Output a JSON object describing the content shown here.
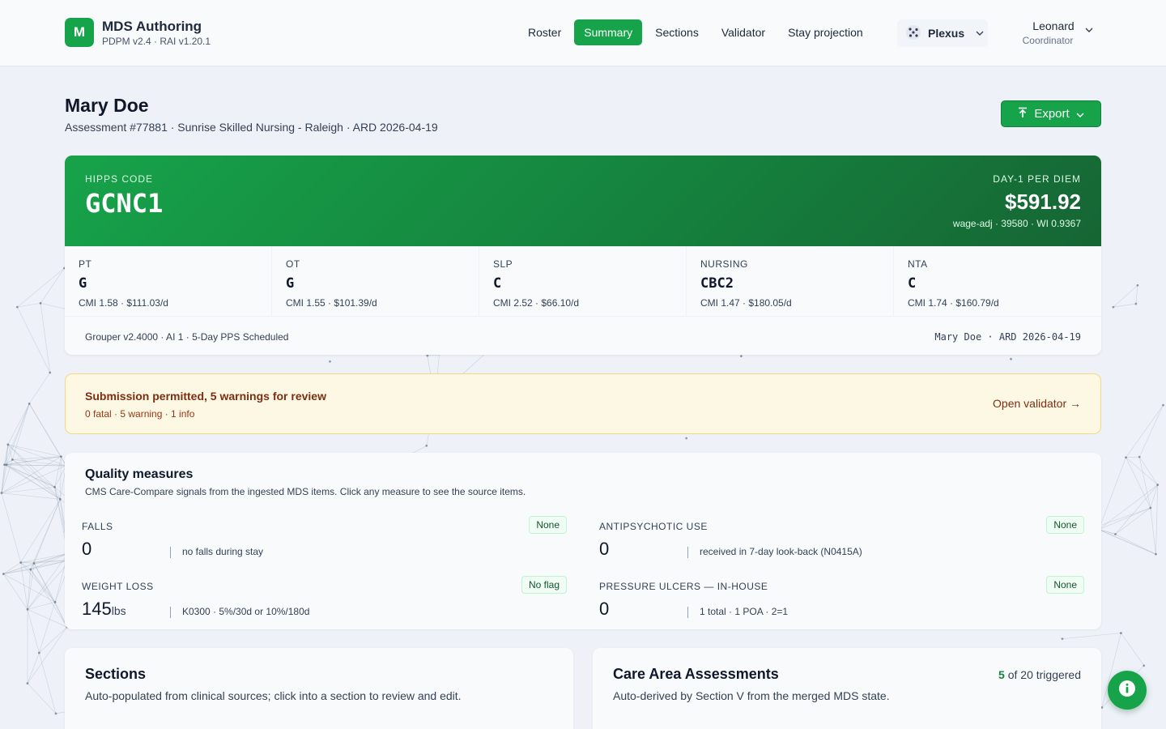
{
  "app": {
    "logo_letter": "M",
    "title": "MDS Authoring",
    "subtitle": "PDPM v2.4 · RAI v1.20.1"
  },
  "nav": {
    "items": [
      {
        "label": "Roster"
      },
      {
        "label": "Summary",
        "active": true
      },
      {
        "label": "Sections"
      },
      {
        "label": "Validator"
      },
      {
        "label": "Stay projection"
      }
    ]
  },
  "org": {
    "name": "Plexus"
  },
  "user": {
    "name": "Leonard",
    "role": "Coordinator"
  },
  "patient": {
    "name": "Mary Doe",
    "meta": "Assessment #77881 · Sunrise Skilled Nursing - Raleigh · ARD 2026-04-19"
  },
  "export": {
    "label": "Export"
  },
  "hipps": {
    "label": "HIPPS CODE",
    "code": "GCNC1",
    "per_diem_label": "DAY-1 PER DIEM",
    "per_diem": "$591.92",
    "wage": "wage-adj · 39580 · WI 0.9367",
    "components": [
      {
        "label": "PT",
        "code": "G",
        "cmi": "CMI 1.58 · $111.03/d"
      },
      {
        "label": "OT",
        "code": "G",
        "cmi": "CMI 1.55 · $101.39/d"
      },
      {
        "label": "SLP",
        "code": "C",
        "cmi": "CMI 2.52 · $66.10/d"
      },
      {
        "label": "NURSING",
        "code": "CBC2",
        "cmi": "CMI 1.47 · $180.05/d"
      },
      {
        "label": "NTA",
        "code": "C",
        "cmi": "CMI 1.74 · $160.79/d"
      }
    ],
    "footer_left": "Grouper v2.4000 · AI 1 · 5-Day PPS Scheduled",
    "footer_right": "Mary Doe · ARD 2026-04-19"
  },
  "validation": {
    "title": "Submission permitted, 5 warnings for review",
    "counts": "0 fatal · 5 warning · 1 info",
    "link": "Open validator →"
  },
  "quality": {
    "title": "Quality measures",
    "subtitle": "CMS Care-Compare signals from the ingested MDS items. Click any measure to see the source items.",
    "measures": [
      {
        "name": "FALLS",
        "badge": "None",
        "value": "0",
        "unit": "",
        "detail": "no falls during stay"
      },
      {
        "name": "ANTIPSYCHOTIC USE",
        "badge": "None",
        "value": "0",
        "unit": "",
        "detail": "received in 7-day look-back (N0415A)"
      },
      {
        "name": "WEIGHT LOSS",
        "badge": "No flag",
        "value": "145",
        "unit": "lbs",
        "detail": "K0300 · 5%/30d or 10%/180d"
      },
      {
        "name": "PRESSURE ULCERS — IN-HOUSE",
        "badge": "None",
        "value": "0",
        "unit": "",
        "detail": "1 total · 1 POA · 2=1"
      }
    ]
  },
  "sections": {
    "title": "Sections",
    "subtitle": "Auto-populated from clinical sources; click into a section to review and edit."
  },
  "caa": {
    "title": "Care Area Assessments",
    "subtitle": "Auto-derived by Section V from the merged MDS state.",
    "triggered": "5",
    "of_total": " of 20 triggered"
  },
  "colors": {
    "accent": "#16a34a",
    "accent_dark": "#15803d",
    "warning_bg": "#fdf8e4",
    "warning_border": "#f3d980",
    "warning_text": "#7c2d12"
  },
  "icons": {
    "logo": "m-logo-icon",
    "org": "plexus-dots-icon",
    "export": "export-icon",
    "chevron": "chevron-down-icon",
    "info": "info-icon"
  }
}
